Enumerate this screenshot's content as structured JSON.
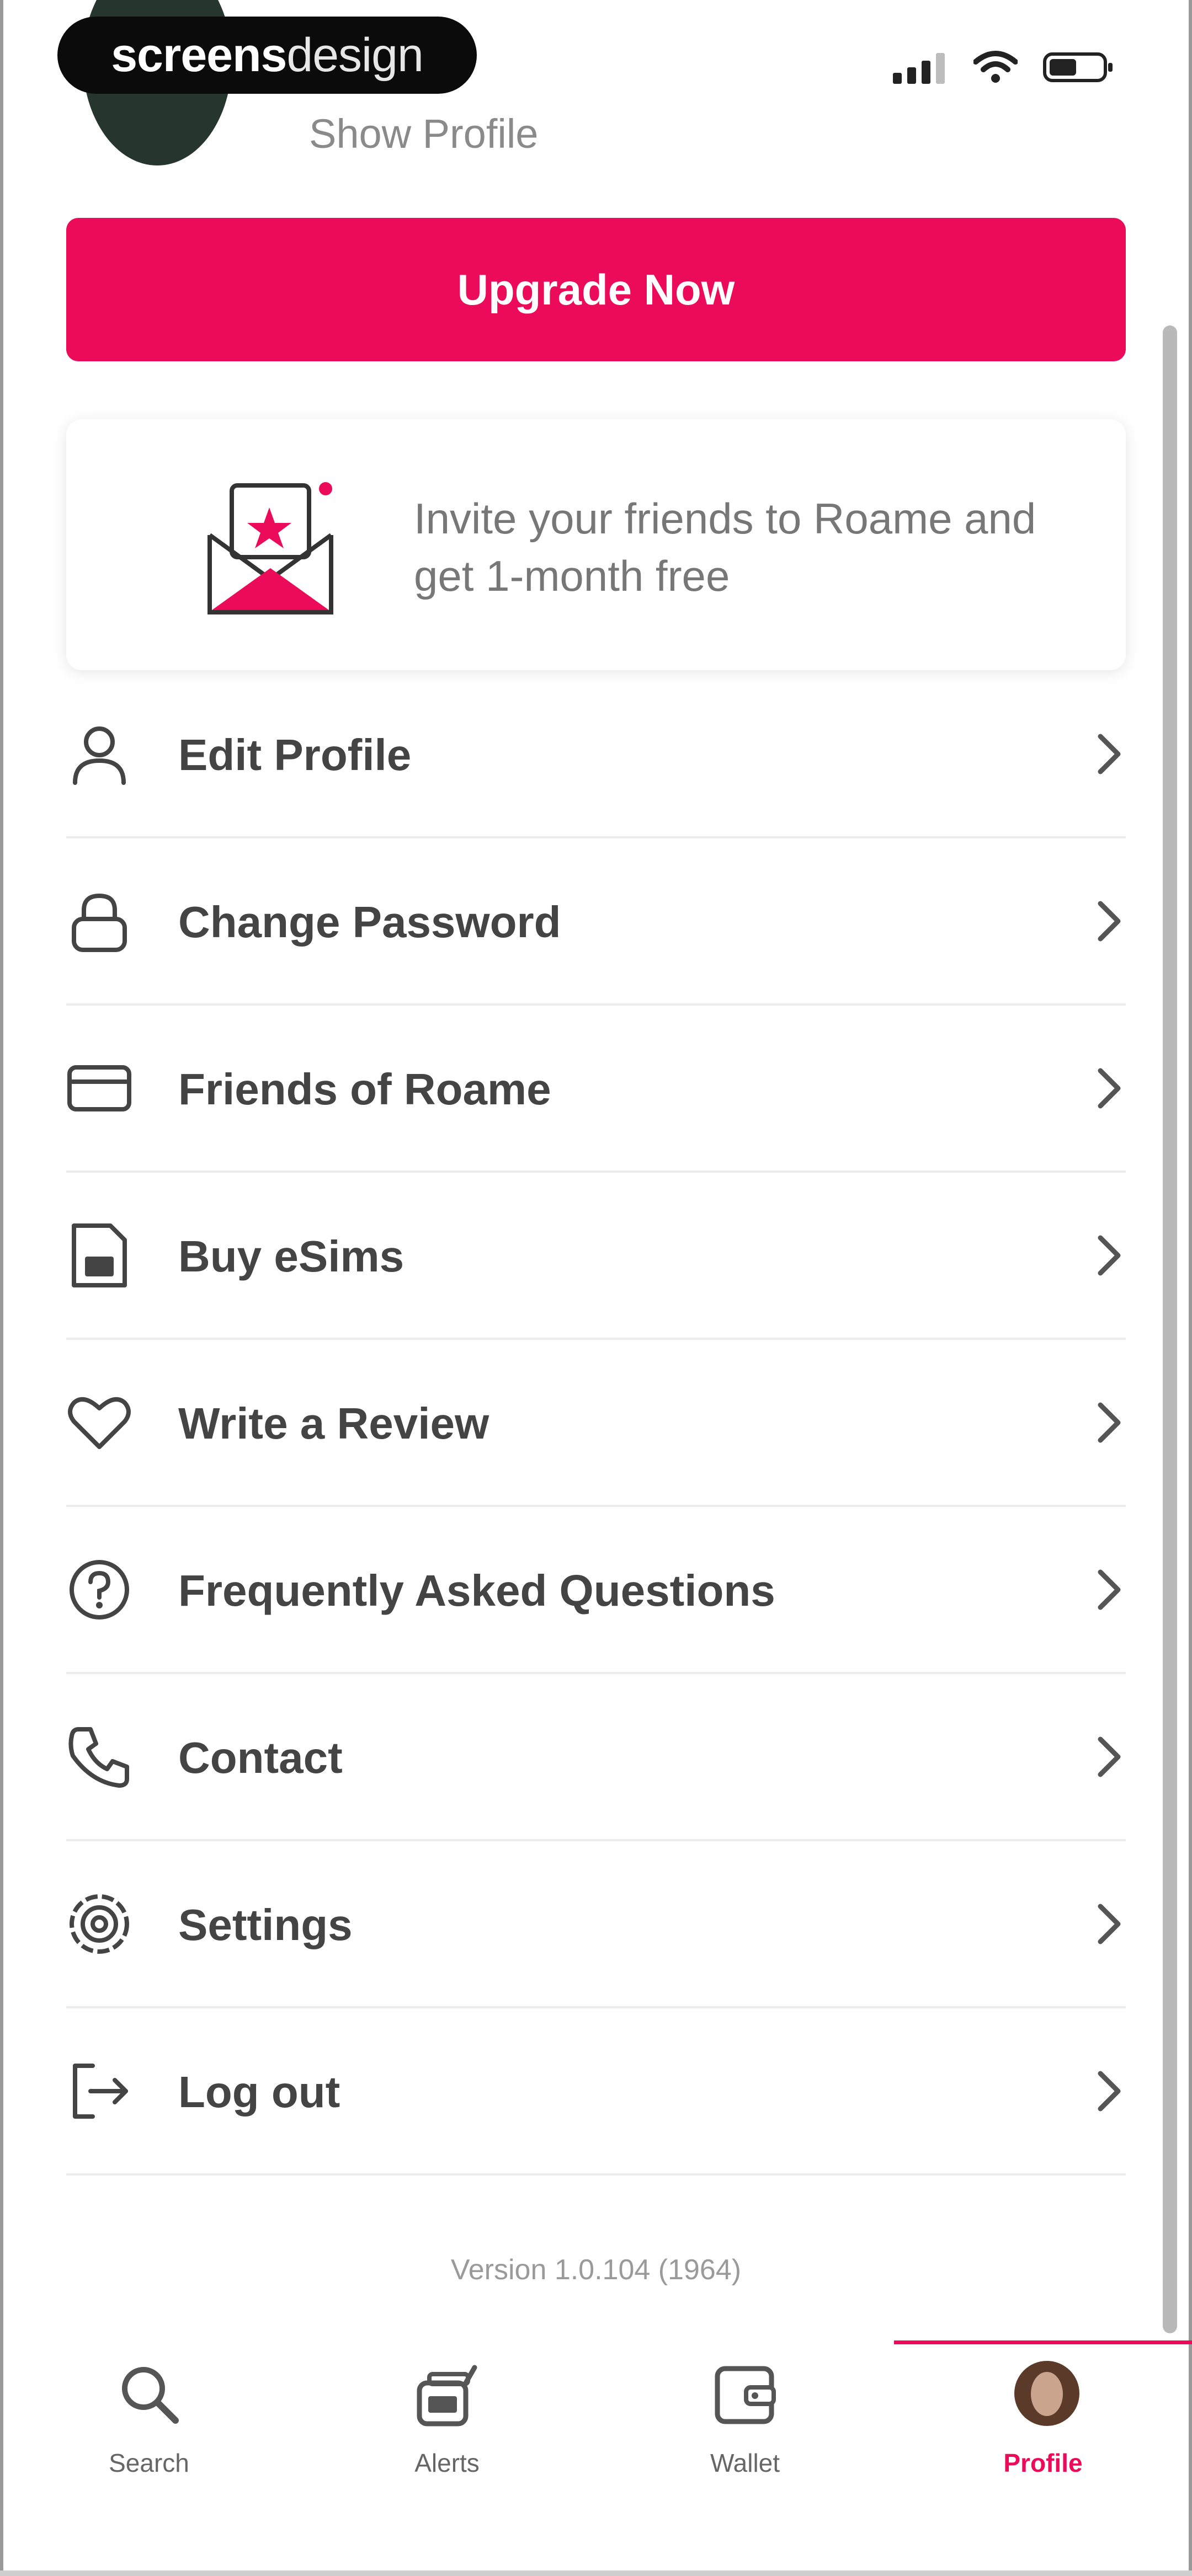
{
  "watermark": {
    "bold": "screens",
    "light": "design"
  },
  "profile": {
    "show_profile_label": "Show Profile"
  },
  "upgrade_label": "Upgrade Now",
  "invite": {
    "text": "Invite your friends to Roame and get 1-month free",
    "icon": "envelope-star-icon"
  },
  "menu": [
    {
      "label": "Edit Profile",
      "icon": "user-icon"
    },
    {
      "label": "Change Password",
      "icon": "lock-icon"
    },
    {
      "label": "Friends of Roame",
      "icon": "card-icon"
    },
    {
      "label": "Buy eSims",
      "icon": "sim-card-icon"
    },
    {
      "label": "Write a Review",
      "icon": "heart-icon"
    },
    {
      "label": "Frequently Asked Questions",
      "icon": "question-circle-icon"
    },
    {
      "label": "Contact",
      "icon": "phone-icon"
    },
    {
      "label": "Settings",
      "icon": "gear-icon"
    },
    {
      "label": "Log out",
      "icon": "logout-icon"
    }
  ],
  "version_text": "Version 1.0.104 (1964)",
  "tabs": [
    {
      "label": "Search",
      "icon": "search-icon",
      "active": false
    },
    {
      "label": "Alerts",
      "icon": "alerts-icon",
      "active": false
    },
    {
      "label": "Wallet",
      "icon": "wallet-icon",
      "active": false
    },
    {
      "label": "Profile",
      "icon": "avatar",
      "active": true
    }
  ],
  "colors": {
    "accent": "#ec0b5a",
    "text": "#444444",
    "muted": "#9a9a9a"
  }
}
